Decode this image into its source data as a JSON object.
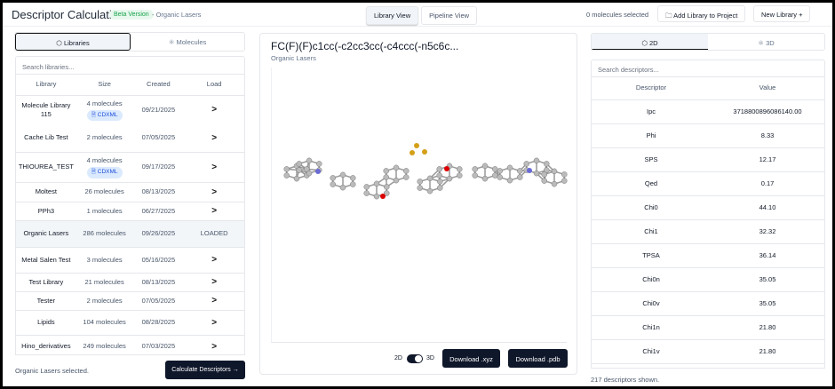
{
  "header": {
    "title": "Descriptor Calculation",
    "beta": "Beta Version",
    "breadcrumb": "- Organic Lasers",
    "views": [
      "Library View",
      "Pipeline View"
    ],
    "selected_count": "0 molecules selected",
    "add_library": "Add Library to Project",
    "new_library": "New Library +"
  },
  "left": {
    "tabs": [
      "Libraries",
      "Molecules"
    ],
    "search_placeholder": "Search libraries...",
    "columns": [
      "Library",
      "Size",
      "Created",
      "Load"
    ],
    "rows": [
      {
        "name": "Molecule Library 115",
        "size": "4 molecules",
        "badge": "CDXML",
        "created": "09/21/2025",
        "load": ">"
      },
      {
        "name": "Cache Lib Test",
        "size": "2 molecules",
        "created": "07/05/2025",
        "load": ">"
      },
      {
        "name": "THIOUREA_TEST",
        "size": "4 molecules",
        "badge": "CDXML",
        "created": "09/17/2025",
        "load": ">"
      },
      {
        "name": "Moltest",
        "size": "26 molecules",
        "created": "08/13/2025",
        "load": ">"
      },
      {
        "name": "PPh3",
        "size": "1 molecules",
        "created": "06/27/2025",
        "load": ">"
      },
      {
        "name": "Organic Lasers",
        "size": "286 molecules",
        "created": "09/26/2025",
        "load": "LOADED"
      },
      {
        "name": "Metal Salen Test",
        "size": "3 molecules",
        "created": "05/16/2025",
        "load": ">"
      },
      {
        "name": "Test Library",
        "size": "21 molecules",
        "created": "08/13/2025",
        "load": ">"
      },
      {
        "name": "Tester",
        "size": "2 molecules",
        "created": "07/05/2025",
        "load": ">"
      },
      {
        "name": "Lipids",
        "size": "104 molecules",
        "created": "08/28/2025",
        "load": ">"
      },
      {
        "name": "Hino_derivatives",
        "size": "249 molecules",
        "created": "07/03/2025",
        "load": ">"
      }
    ],
    "status": "Organic Lasers selected.",
    "calculate": "Calculate Descriptors →"
  },
  "center": {
    "smiles": "FC(F)(F)c1cc(-c2cc3cc(-c4ccc(-n5c6c...",
    "library": "Organic Lasers",
    "toggle_2d": "2D",
    "toggle_3d": "3D",
    "toggle_value": "3D",
    "download_xyz": "Download .xyz",
    "download_pdb": "Download .pdb"
  },
  "right": {
    "tabs": [
      "2D",
      "3D"
    ],
    "search_placeholder": "Search descriptors...",
    "columns": [
      "Descriptor",
      "Value"
    ],
    "rows": [
      [
        "Ipc",
        "3718800896086140.00"
      ],
      [
        "Phi",
        "8.33"
      ],
      [
        "SPS",
        "12.17"
      ],
      [
        "Qed",
        "0.17"
      ],
      [
        "Chi0",
        "44.10"
      ],
      [
        "Chi1",
        "32.32"
      ],
      [
        "TPSA",
        "36.14"
      ],
      [
        "Chi0n",
        "35.05"
      ],
      [
        "Chi0v",
        "35.05"
      ],
      [
        "Chi1n",
        "21.80"
      ],
      [
        "Chi1v",
        "21.80"
      ]
    ],
    "status": "217 descriptors shown."
  },
  "colors": {
    "accent": "#0f172a",
    "beta": "#16a34a",
    "badge": "#1d4ed8"
  }
}
